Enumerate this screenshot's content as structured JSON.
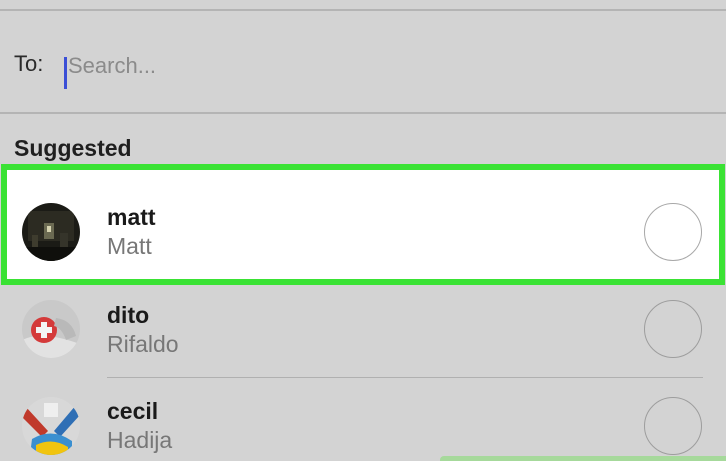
{
  "compose": {
    "to_label": "To:",
    "search_placeholder": "Search..."
  },
  "suggested": {
    "title": "Suggested",
    "contacts": [
      {
        "username": "matt",
        "name": "Matt",
        "selected_highlight": true
      },
      {
        "username": "dito",
        "name": "Rifaldo",
        "selected_highlight": false
      },
      {
        "username": "cecil",
        "name": "Hadija",
        "selected_highlight": false
      }
    ]
  },
  "colors": {
    "highlight": "#3ae234",
    "caret": "#3b4fd6",
    "background": "#d3d3d3"
  },
  "icons": {
    "avatars": [
      "avatar-dark-photo-icon",
      "avatar-red-cross-icon",
      "avatar-sneakers-photo-icon"
    ],
    "select": "select-circle-icon"
  }
}
